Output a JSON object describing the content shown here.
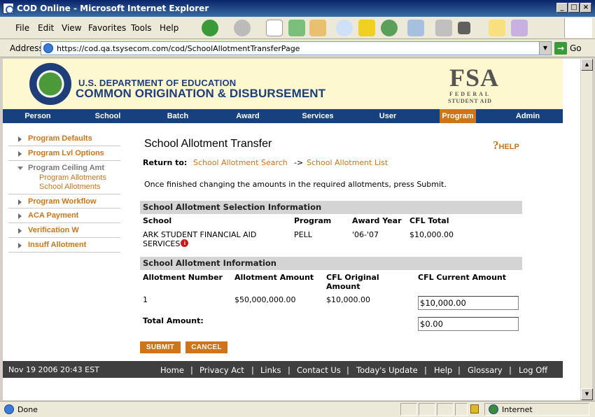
{
  "window": {
    "title": "COD Online - Microsoft Internet Explorer",
    "buttons": {
      "minimize": "_",
      "maximize": "□",
      "close": "×"
    }
  },
  "menubar": {
    "items": [
      "File",
      "Edit",
      "View",
      "Favorites",
      "Tools",
      "Help"
    ]
  },
  "addressbar": {
    "label": "Address",
    "url": "https://cod.qa.tsysecom.com/cod/SchoolAllotmentTransferPage",
    "go_label": "Go"
  },
  "header": {
    "dept": "U.S. DEPARTMENT OF EDUCATION",
    "system": "COMMON ORIGINATION & DISBURSEMENT",
    "fsa_logo": {
      "letters": "FSA",
      "line1": "FEDERAL",
      "line2": "STUDENT AID"
    }
  },
  "topnav": {
    "items": [
      "Person",
      "School",
      "Batch",
      "Award",
      "Services",
      "User",
      "Program",
      "Admin"
    ],
    "active": "Program",
    "colors": {
      "bar": "#17407e",
      "active": "#d0741a"
    }
  },
  "leftnav": {
    "items": [
      "Program Defaults",
      "Program Lvl Options",
      "Program Ceiling Amt",
      "Program Workflow",
      "ACA Payment",
      "Verification W",
      "Insuff Allotment"
    ],
    "subitems": [
      "Program Allotments",
      "School Allotments"
    ]
  },
  "content": {
    "title": "School Allotment Transfer",
    "help": "HELP",
    "return_to_label": "Return to:",
    "links": {
      "search": "School Allotment Search",
      "arrow": "->",
      "list": "School Allotment List"
    },
    "instructions": "Once finished changing the amounts in the required allotments, press Submit.",
    "selection": {
      "heading": "School Allotment Selection Information",
      "headers": {
        "school": "School",
        "program": "Program",
        "award_year": "Award Year",
        "cfl_total": "CFL Total"
      },
      "row": {
        "school_line1": "ARK STUDENT FINANCIAL AID",
        "school_line2": "SERVICES",
        "program": "PELL",
        "award_year": "'06-'07",
        "cfl_total": "$10,000.00"
      }
    },
    "allotment": {
      "heading": "School Allotment Information",
      "headers": {
        "number": "Allotment Number",
        "amount": "Allotment Amount",
        "cfl_original_1": "CFL Original",
        "cfl_original_2": "Amount",
        "cfl_current": "CFL Current Amount"
      },
      "row": {
        "number": "1",
        "amount": "$50,000,000.00",
        "cfl_original": "$10,000.00",
        "cfl_current": "$10,000.00"
      },
      "total_label": "Total Amount:",
      "total_value": "$0.00"
    },
    "buttons": {
      "submit": "SUBMIT",
      "cancel": "CANCEL"
    }
  },
  "footer": {
    "timestamp": "Nov 19 2006 20:43 EST",
    "links": [
      "Home",
      "Privacy Act",
      "Links",
      "Contact Us",
      "Today's Update",
      "Help",
      "Glossary",
      "Log Off"
    ]
  },
  "statusbar": {
    "text": "Done",
    "zone": "Internet"
  }
}
